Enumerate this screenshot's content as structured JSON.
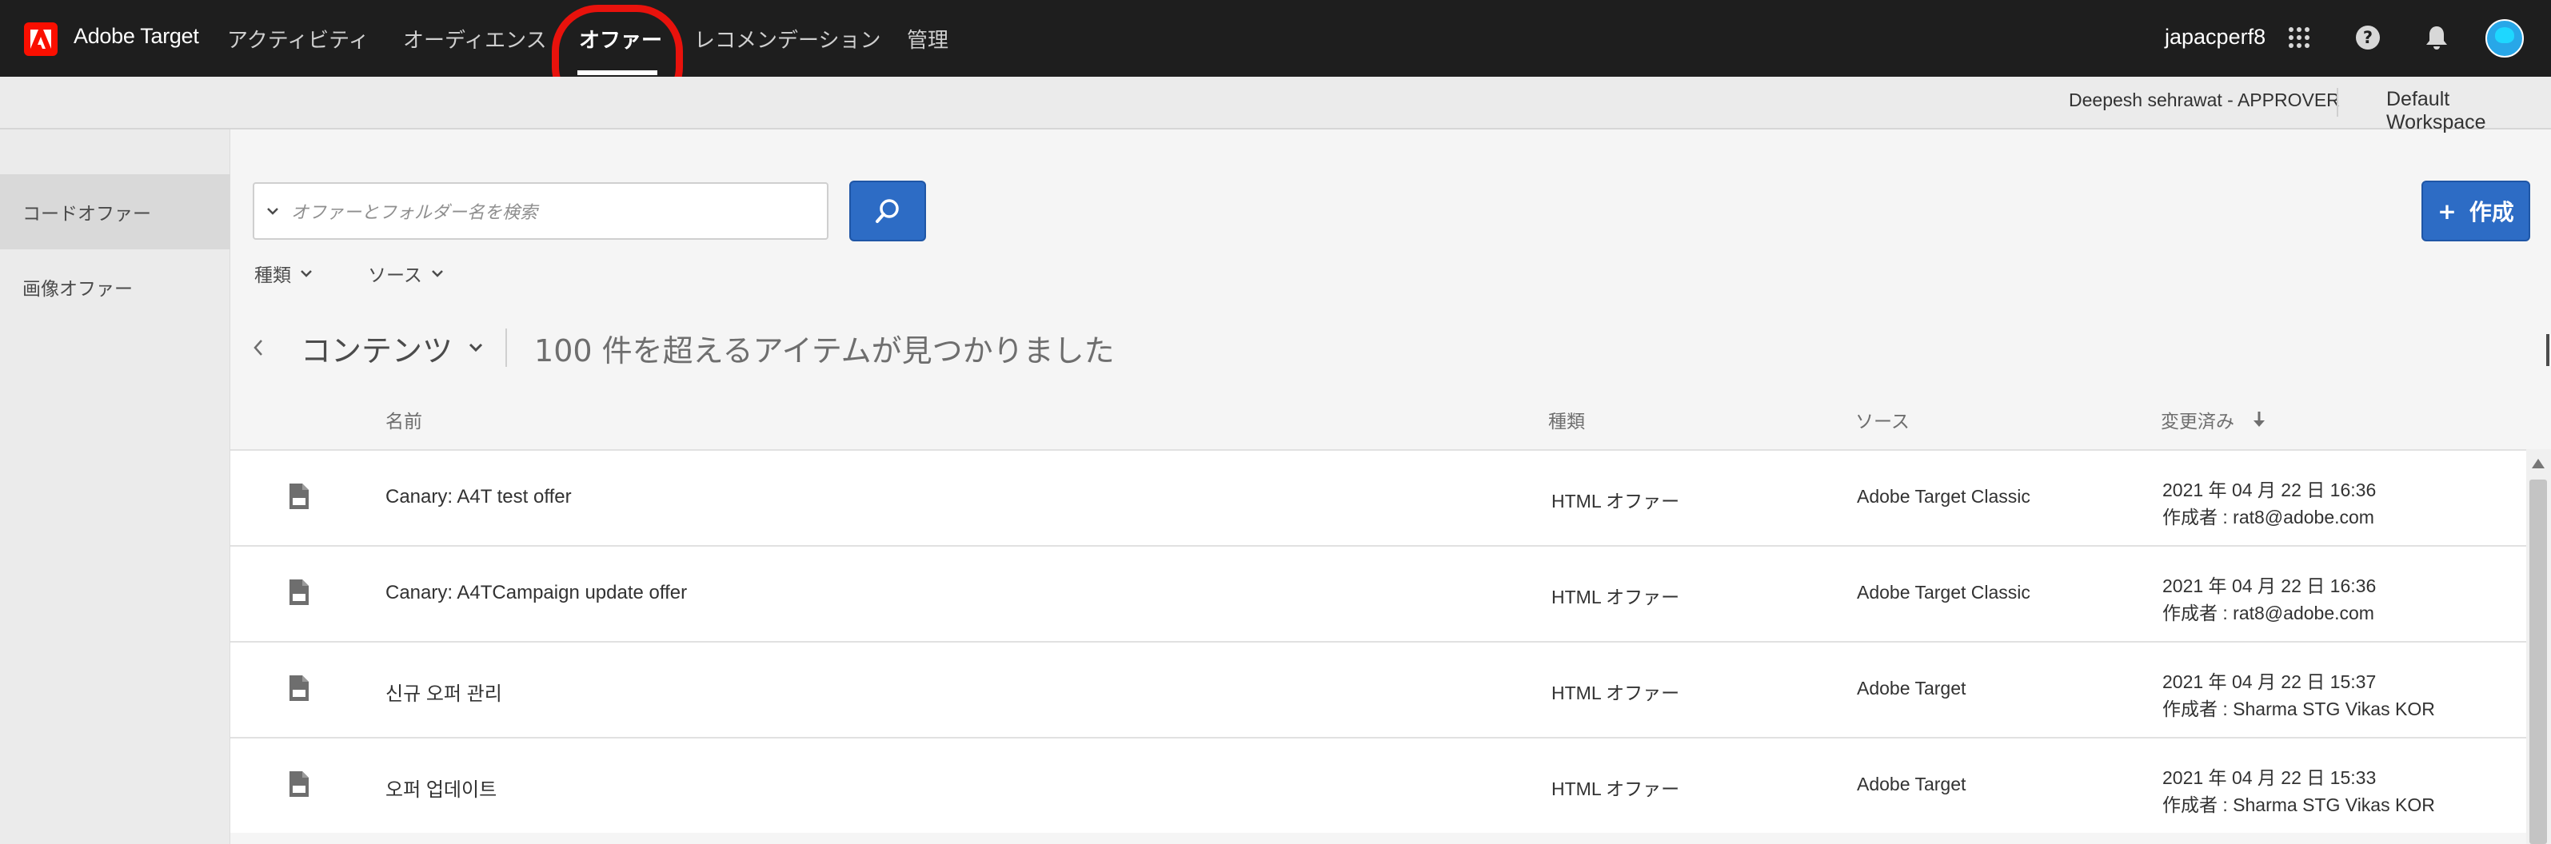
{
  "app": {
    "brand": "Adobe Target",
    "nav": [
      "アクティビティ",
      "オーディエンス",
      "オファー",
      "レコメンデーション",
      "管理"
    ],
    "active_nav": "オファー",
    "org": "japacperf8",
    "icons": [
      "apps-grid-icon",
      "help-icon",
      "notification-bell-icon",
      "user-avatar"
    ]
  },
  "workspace_bar": {
    "user": "Deepesh sehrawat - APPROVER",
    "workspace": "Default Workspace"
  },
  "sidebar": {
    "items": [
      {
        "label": "コードオファー",
        "selected": true
      },
      {
        "label": "画像オファー",
        "selected": false
      }
    ]
  },
  "toolbar": {
    "search_placeholder": "オファーとフォルダー名を検索",
    "create_label": "作成",
    "filters": [
      "種類",
      "ソース"
    ]
  },
  "breadcrumb": {
    "folder": "コンテンツ",
    "count_text": "100 件を超えるアイテムが見つかりました"
  },
  "table": {
    "columns": [
      "名前",
      "種類",
      "ソース",
      "変更済み"
    ],
    "sort_column": "変更済み",
    "rows": [
      {
        "name": "Canary: A4T test offer",
        "type": "HTML オファー",
        "source": "Adobe Target Classic",
        "modified": "2021 年 04 月 22 日  16:36",
        "author": "作成者 : rat8@adobe.com"
      },
      {
        "name": "Canary: A4TCampaign update offer",
        "type": "HTML オファー",
        "source": "Adobe Target Classic",
        "modified": "2021 年 04 月 22 日  16:36",
        "author": "作成者 : rat8@adobe.com"
      },
      {
        "name": "신규 오퍼 관리",
        "type": "HTML オファー",
        "source": "Adobe Target",
        "modified": "2021 年 04 月 22 日  15:37",
        "author": "作成者 : Sharma STG Vikas KOR"
      },
      {
        "name": "오퍼 업데이트",
        "type": "HTML オファー",
        "source": "Adobe Target",
        "modified": "2021 年 04 月 22 日  15:33",
        "author": "作成者 : Sharma STG Vikas KOR"
      }
    ]
  },
  "colors": {
    "topnav_bg": "#1e1e1e",
    "accent_blue": "#2d6cc5",
    "adobe_red": "#fa0f00",
    "highlight_ring": "#e8120c"
  }
}
